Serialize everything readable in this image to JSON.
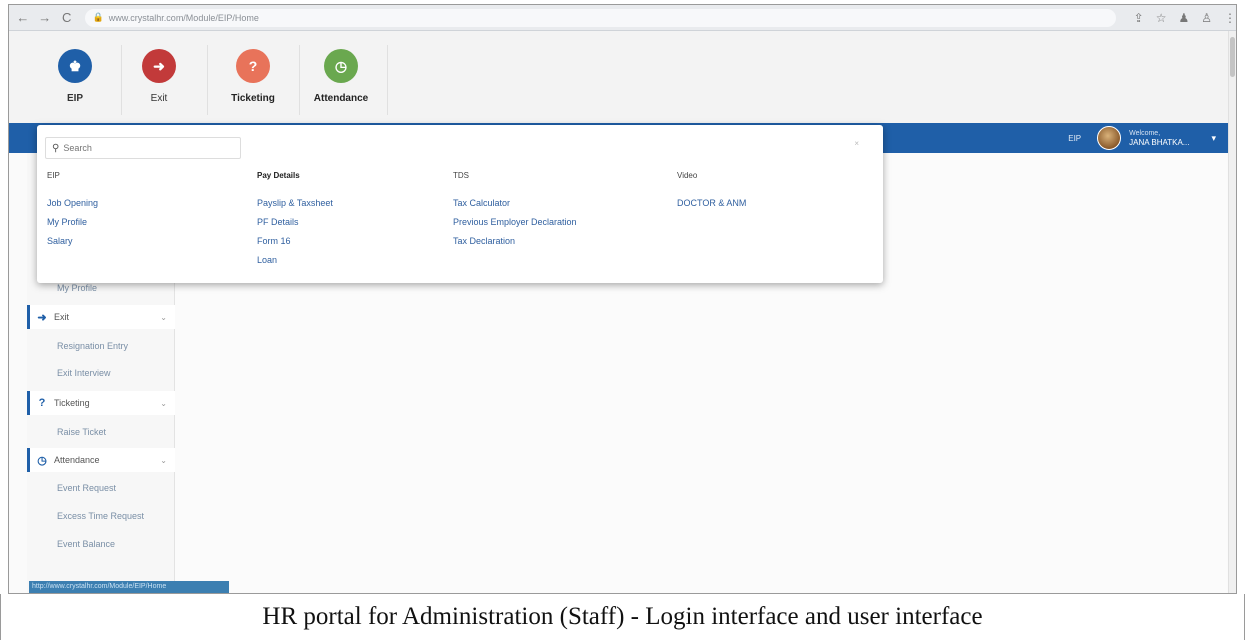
{
  "browser": {
    "url": "www.crystalhr.com/Module/EIP/Home",
    "back_glyph": "←",
    "forward_glyph": "→",
    "reload_glyph": "C",
    "lock_glyph": "🔒",
    "share_glyph": "⇪",
    "star_glyph": "☆",
    "ext_glyph": "♟",
    "profile_glyph": "♙",
    "menu_glyph": "⋮"
  },
  "modules": [
    {
      "label": "EIP",
      "glyph": "♚",
      "color": "#1f5fa8"
    },
    {
      "label": "Exit",
      "glyph": "➜",
      "color": "#c23a3a"
    },
    {
      "label": "Ticketing",
      "glyph": "?",
      "color": "#e8735a"
    },
    {
      "label": "Attendance",
      "glyph": "◷",
      "color": "#6aa84f"
    }
  ],
  "header": {
    "eip_switch": "EIP",
    "welcome_line": "Welcome,",
    "user_name": "JANA BHATKA...",
    "caret": "▾"
  },
  "mega_menu": {
    "search_placeholder": "Search",
    "search_icon": "search-icon",
    "close_glyph": "×",
    "columns": [
      {
        "heading": "EIP",
        "bold": false,
        "items": [
          "Job Opening",
          "My Profile",
          "Salary"
        ]
      },
      {
        "heading": "Pay Details",
        "bold": true,
        "items": [
          "Payslip & Taxsheet",
          "PF Details",
          "Form 16",
          "Loan"
        ]
      },
      {
        "heading": "TDS",
        "bold": false,
        "items": [
          "Tax Calculator",
          "Previous Employer Declaration",
          "Tax Declaration"
        ]
      },
      {
        "heading": "Video",
        "bold": false,
        "items": [
          "DOCTOR & ANM"
        ]
      }
    ]
  },
  "sidebar": {
    "top_sub": "My Profile",
    "sections": [
      {
        "label": "Exit",
        "icon": "exit-icon",
        "glyph": "➜",
        "subs": [
          "Resignation Entry",
          "Exit Interview"
        ]
      },
      {
        "label": "Ticketing",
        "icon": "question-icon",
        "glyph": "?",
        "subs": [
          "Raise Ticket"
        ]
      },
      {
        "label": "Attendance",
        "icon": "clock-icon",
        "glyph": "◷",
        "subs": [
          "Event Request",
          "Excess Time Request",
          "Event Balance"
        ]
      }
    ],
    "chevron": "⌄",
    "status_strip": "http://www.crystalhr.com/Module/EIP/Home"
  },
  "caption": "HR portal for Administration (Staff) - Login interface and user interface",
  "colors": {
    "primary_blue": "#1f5fa8",
    "exit_red": "#c23a3a",
    "ticket_orange": "#e8735a",
    "attendance_green": "#6aa84f",
    "link_blue": "#2f5f9f"
  }
}
